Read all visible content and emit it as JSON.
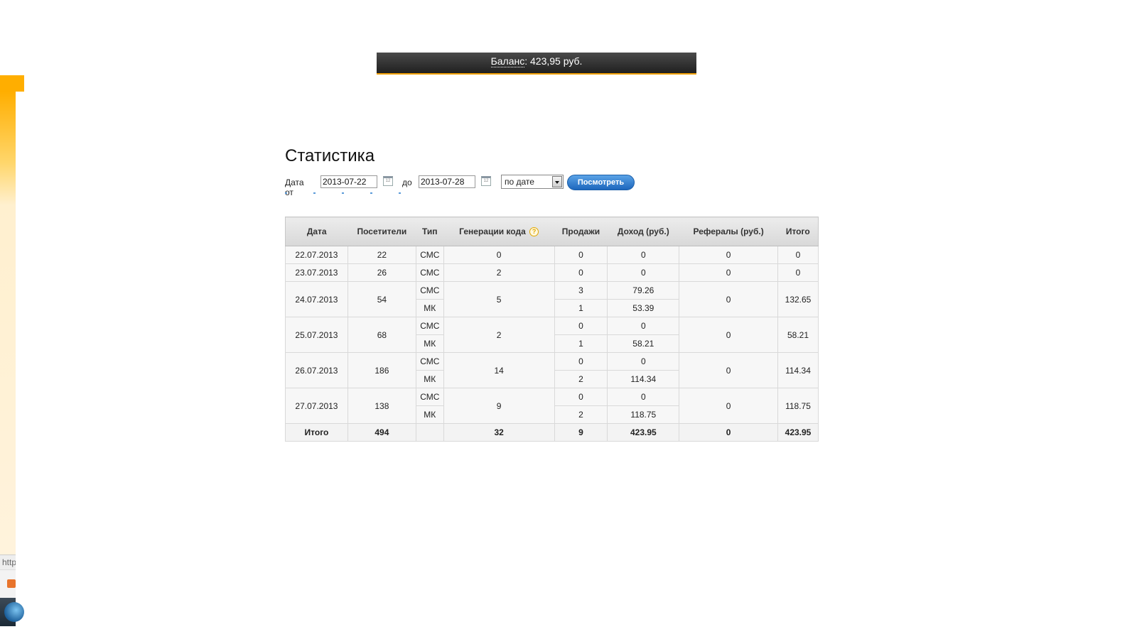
{
  "balance": {
    "label": "Баланс",
    "value": ": 423,95 руб."
  },
  "page_title": "Статистика",
  "filters": {
    "from_label": "Дата от",
    "from_value": "2013-07-22",
    "to_label": "до",
    "to_value": "2013-07-28",
    "calendar_icon_text": "12",
    "group_select": "по дате",
    "submit_label": "Посмотреть"
  },
  "side": {
    "url_fragment": "http"
  },
  "table": {
    "headers": [
      "Дата",
      "Посетители",
      "Тип",
      "Генерации кода",
      "Продажи",
      "Доход (руб.)",
      "Рефералы (руб.)",
      "Итого"
    ],
    "help_icon": "?",
    "days": [
      {
        "date": "22.07.2013",
        "visitors": "22",
        "codes": "0",
        "referrals": "0",
        "total": "0",
        "types": [
          {
            "type": "СМС",
            "sales": "0",
            "income": "0"
          }
        ]
      },
      {
        "date": "23.07.2013",
        "visitors": "26",
        "codes": "2",
        "referrals": "0",
        "total": "0",
        "types": [
          {
            "type": "СМС",
            "sales": "0",
            "income": "0"
          }
        ]
      },
      {
        "date": "24.07.2013",
        "visitors": "54",
        "codes": "5",
        "referrals": "0",
        "total": "132.65",
        "types": [
          {
            "type": "СМС",
            "sales": "3",
            "income": "79.26"
          },
          {
            "type": "МК",
            "sales": "1",
            "income": "53.39"
          }
        ]
      },
      {
        "date": "25.07.2013",
        "visitors": "68",
        "codes": "2",
        "referrals": "0",
        "total": "58.21",
        "types": [
          {
            "type": "СМС",
            "sales": "0",
            "income": "0"
          },
          {
            "type": "МК",
            "sales": "1",
            "income": "58.21"
          }
        ]
      },
      {
        "date": "26.07.2013",
        "visitors": "186",
        "codes": "14",
        "referrals": "0",
        "total": "114.34",
        "types": [
          {
            "type": "СМС",
            "sales": "0",
            "income": "0"
          },
          {
            "type": "МК",
            "sales": "2",
            "income": "114.34"
          }
        ]
      },
      {
        "date": "27.07.2013",
        "visitors": "138",
        "codes": "9",
        "referrals": "0",
        "total": "118.75",
        "types": [
          {
            "type": "СМС",
            "sales": "0",
            "income": "0"
          },
          {
            "type": "МК",
            "sales": "2",
            "income": "118.75"
          }
        ]
      }
    ],
    "totals": {
      "label": "Итого",
      "visitors": "494",
      "type": "",
      "codes": "32",
      "sales": "9",
      "income": "423.95",
      "referrals": "0",
      "total": "423.95"
    }
  },
  "colors": {
    "accent": "#ffae00",
    "button": "#1d67bd",
    "bar": "#2a2a2a"
  }
}
